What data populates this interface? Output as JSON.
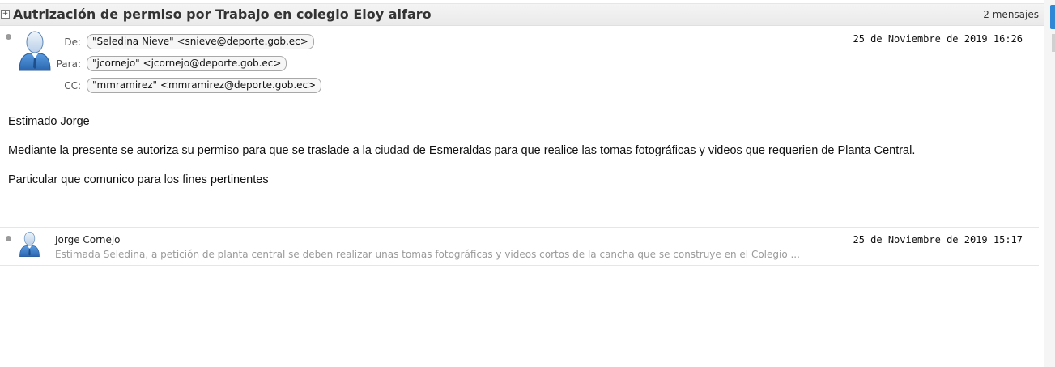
{
  "thread": {
    "subject": "Autrización de permiso por Trabajo en colegio Eloy alfaro",
    "message_count": "2 mensajes",
    "expand_symbol": "⊞"
  },
  "message1": {
    "from_label": "De:",
    "from": "\"Seledina Nieve\" <snieve@deporte.gob.ec>",
    "to_label": "Para:",
    "to": "\"jcornejo\" <jcornejo@deporte.gob.ec>",
    "cc_label": "CC:",
    "cc": "\"mmramirez\" <mmramirez@deporte.gob.ec>",
    "date": "25 de Noviembre de 2019 16:26",
    "body": {
      "greeting": "Estimado Jorge",
      "paragraph": "Mediante la presente se autoriza su permiso para que se traslade a la ciudad de Esmeraldas para que realice las tomas fotográficas y videos que requerien de Planta Central.",
      "closing": "Particular que comunico para los fines pertinentes"
    },
    "avatar_icon": "user-avatar-icon"
  },
  "message2": {
    "sender": "Jorge Cornejo",
    "date": "25 de Noviembre de 2019 15:17",
    "preview": "Estimada Seledina, a petición de planta central se deben realizar unas tomas fotográficas y videos cortos de la cancha que se construye en el Colegio ...",
    "avatar_icon": "user-avatar-icon"
  },
  "colors": {
    "accent": "#2f87d6",
    "avatar_blue": "#3b7fc4",
    "preview_gray": "#9a9a9a"
  }
}
